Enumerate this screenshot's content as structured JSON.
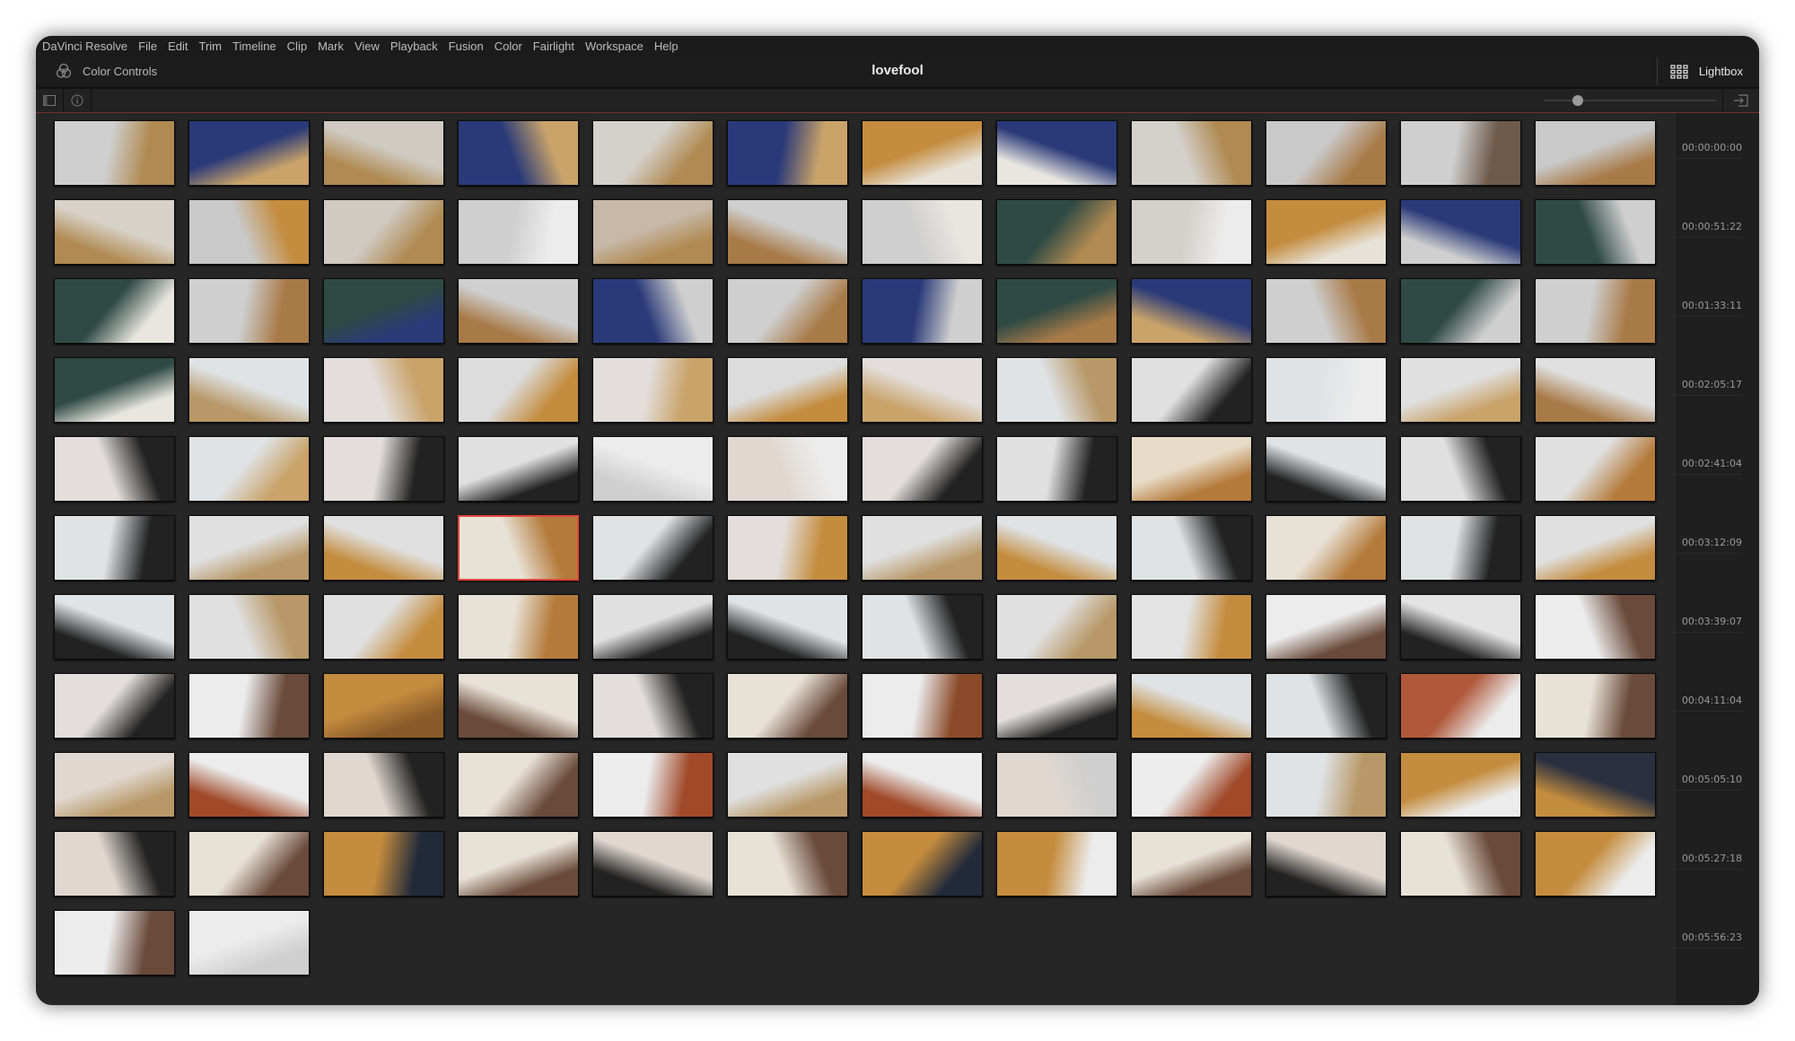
{
  "menu": [
    "DaVinci Resolve",
    "File",
    "Edit",
    "Trim",
    "Timeline",
    "Clip",
    "Mark",
    "View",
    "Playback",
    "Fusion",
    "Color",
    "Fairlight",
    "Workspace",
    "Help"
  ],
  "header": {
    "panel_label": "Color Controls",
    "project_title": "lovefool",
    "lightbox_label": "Lightbox"
  },
  "toolbar": {
    "zoom_slider_value": 0.2
  },
  "timecodes": [
    "00:00:00:00",
    "00:00:51:22",
    "00:01:33:11",
    "00:02:05:17",
    "00:02:41:04",
    "00:03:12:09",
    "00:03:39:07",
    "00:04:11:04",
    "00:05:05:10",
    "00:05:27:18",
    "00:05:56:23"
  ],
  "colors": {
    "selection": "#e0463a",
    "background": "#262626"
  },
  "selected_clip": 64,
  "clips": [
    [
      "#cfcfcf",
      "#b08a52"
    ],
    [
      "#2a3a78",
      "#c9a36a"
    ],
    [
      "#cfcac2",
      "#b08a52"
    ],
    [
      "#2a3a78",
      "#c9a36a"
    ],
    [
      "#d4d0ca",
      "#b08a52"
    ],
    [
      "#2a3a78",
      "#c9a36a"
    ],
    [
      "#c48c3e",
      "#e7e2d8"
    ],
    [
      "#2a3a78",
      "#e9e6e0"
    ],
    [
      "#d4d0ca",
      "#b08a52"
    ],
    [
      "#c9c9c9",
      "#a87a48"
    ],
    [
      "#cfcfcf",
      "#6e5a4a"
    ],
    [
      "#c9c9c9",
      "#a87a48"
    ],
    [
      "#d8d2c8",
      "#b08a52"
    ],
    [
      "#c9c9c9",
      "#c48c3e"
    ],
    [
      "#cfcac2",
      "#b08a52"
    ],
    [
      "#cfcfcf",
      "#ececec"
    ],
    [
      "#c7b8a8",
      "#b08a52"
    ],
    [
      "#cfcfcf",
      "#a87a48"
    ],
    [
      "#cfcfcf",
      "#e9e6e0"
    ],
    [
      "#2f4a44",
      "#b08a52"
    ],
    [
      "#d4d0ca",
      "#ececec"
    ],
    [
      "#c48c3e",
      "#e7e2d8"
    ],
    [
      "#2a3a78",
      "#cfcfcf"
    ],
    [
      "#2f4a44",
      "#cfcfcf"
    ],
    [
      "#2f4a44",
      "#e9e6e0"
    ],
    [
      "#cfcfcf",
      "#a87a48"
    ],
    [
      "#2f4a44",
      "#2a3a78"
    ],
    [
      "#cfcfcf",
      "#a87a48"
    ],
    [
      "#2a3a78",
      "#cfcfcf"
    ],
    [
      "#cfcfcf",
      "#a87a48"
    ],
    [
      "#2a3a78",
      "#cfcfcf"
    ],
    [
      "#2f4a44",
      "#a87a48"
    ],
    [
      "#2a3a78",
      "#c9a36a"
    ],
    [
      "#cfcfcf",
      "#a87a48"
    ],
    [
      "#2f4a44",
      "#cfcfcf"
    ],
    [
      "#cfcfcf",
      "#a87a48"
    ],
    [
      "#2f4a44",
      "#e9e6e0"
    ],
    [
      "#dfe3e6",
      "#b89868"
    ],
    [
      "#e3dedb",
      "#c9a36a"
    ],
    [
      "#dcdcdc",
      "#c48c3e"
    ],
    [
      "#e3dedb",
      "#c9a36a"
    ],
    [
      "#dcdcdc",
      "#c48c3e"
    ],
    [
      "#e3dedb",
      "#c9a36a"
    ],
    [
      "#dfe3e6",
      "#b89868"
    ],
    [
      "#e0e0e0",
      "#222222"
    ],
    [
      "#dfe3e6",
      "#ececec"
    ],
    [
      "#e0e0e0",
      "#c9a36a"
    ],
    [
      "#e0e0e0",
      "#a87a48"
    ],
    [
      "#e3dedb",
      "#222222"
    ],
    [
      "#dfe3e6",
      "#c9a36a"
    ],
    [
      "#e3dedb",
      "#222222"
    ],
    [
      "#e0e0e0",
      "#222222"
    ],
    [
      "#ececec",
      "#cfcfcf"
    ],
    [
      "#e0d8d0",
      "#ececec"
    ],
    [
      "#e3dedb",
      "#222222"
    ],
    [
      "#e0e0e0",
      "#222222"
    ],
    [
      "#e8dcc8",
      "#b47a3a"
    ],
    [
      "#dfe3e6",
      "#222222"
    ],
    [
      "#e0e0e0",
      "#222222"
    ],
    [
      "#e0e0e0",
      "#b47a3a"
    ],
    [
      "#dfe3e6",
      "#222222"
    ],
    [
      "#e0e0e0",
      "#b89868"
    ],
    [
      "#e0e0e0",
      "#c48c3e"
    ],
    [
      "#e8e2d6",
      "#b47a3a"
    ],
    [
      "#dfe3e6",
      "#222222"
    ],
    [
      "#e3dedb",
      "#c48c3e"
    ],
    [
      "#e0e0e0",
      "#b89868"
    ],
    [
      "#dfe3e6",
      "#c48c3e"
    ],
    [
      "#dfe3e6",
      "#222222"
    ],
    [
      "#e8e2d6",
      "#b47a3a"
    ],
    [
      "#dfe3e6",
      "#222222"
    ],
    [
      "#e0e0e0",
      "#c48c3e"
    ],
    [
      "#dfe3e6",
      "#222222"
    ],
    [
      "#e0e0e0",
      "#b89868"
    ],
    [
      "#e0e0e0",
      "#c48c3e"
    ],
    [
      "#e8e2d6",
      "#b47a3a"
    ],
    [
      "#e0e0e0",
      "#222222"
    ],
    [
      "#dfe3e6",
      "#222222"
    ],
    [
      "#dfe3e6",
      "#222222"
    ],
    [
      "#e0e0e0",
      "#b89868"
    ],
    [
      "#e3e3e3",
      "#c48c3e"
    ],
    [
      "#ececec",
      "#6a4a3a"
    ],
    [
      "#e3e3e3",
      "#222222"
    ],
    [
      "#ececec",
      "#6a4a3a"
    ],
    [
      "#e3dedb",
      "#222222"
    ],
    [
      "#ececec",
      "#6a4a3a"
    ],
    [
      "#c48c3e",
      "#8a5a2a"
    ],
    [
      "#e8e2d6",
      "#6a4a3a"
    ],
    [
      "#e3dedb",
      "#222222"
    ],
    [
      "#e8e2d6",
      "#6a4a3a"
    ],
    [
      "#ececec",
      "#8a4a2a"
    ],
    [
      "#e3dedb",
      "#222222"
    ],
    [
      "#dfe3e6",
      "#c48c3e"
    ],
    [
      "#dfe3e6",
      "#222222"
    ],
    [
      "#b0583a",
      "#ececec"
    ],
    [
      "#e8e2d6",
      "#6a4a3a"
    ],
    [
      "#e0d8d0",
      "#b89868"
    ],
    [
      "#ececec",
      "#a04a2a"
    ],
    [
      "#e0d8d0",
      "#222222"
    ],
    [
      "#e8e2d6",
      "#6a4a3a"
    ],
    [
      "#ececec",
      "#a04a2a"
    ],
    [
      "#e0e0e0",
      "#b89868"
    ],
    [
      "#ececec",
      "#a04a2a"
    ],
    [
      "#e0d8d0",
      "#cfcfcf"
    ],
    [
      "#ececec",
      "#a04a2a"
    ],
    [
      "#dfe3e6",
      "#b89868"
    ],
    [
      "#c48c3e",
      "#ececec"
    ],
    [
      "#2a3040",
      "#c48c3e"
    ],
    [
      "#e0d8d0",
      "#222222"
    ],
    [
      "#e8e2d6",
      "#6a4a3a"
    ],
    [
      "#c48c3e",
      "#222a3a"
    ],
    [
      "#e8e2d6",
      "#6a4a3a"
    ],
    [
      "#e0d8d0",
      "#222222"
    ],
    [
      "#e8e2d6",
      "#6a4a3a"
    ],
    [
      "#c48c3e",
      "#222a3a"
    ],
    [
      "#c48c3e",
      "#ececec"
    ],
    [
      "#e8e2d6",
      "#6a4a3a"
    ],
    [
      "#e0d8d0",
      "#222222"
    ],
    [
      "#e8e2d6",
      "#6a4a3a"
    ],
    [
      "#c48c3e",
      "#ececec"
    ],
    [
      "#ececec",
      "#6a4a3a"
    ],
    [
      "#ececec",
      "#cfcfcf"
    ]
  ]
}
